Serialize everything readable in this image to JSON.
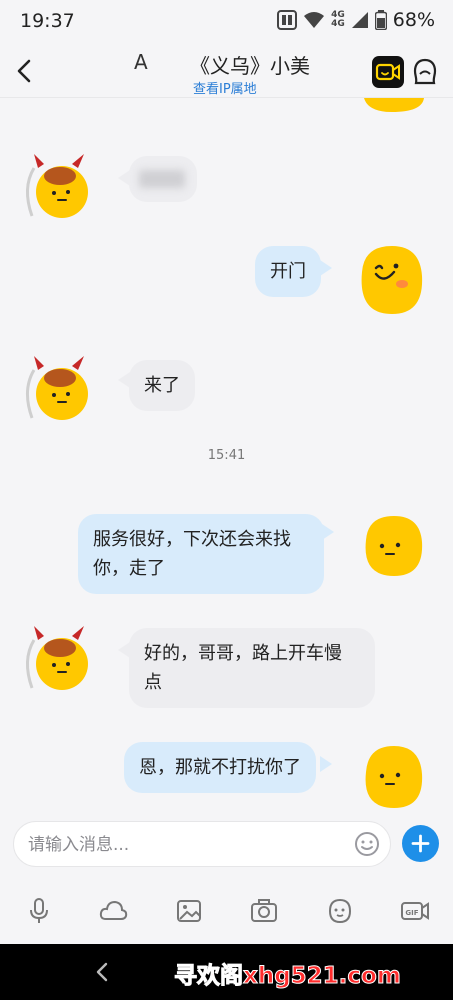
{
  "status_bar": {
    "time": "19:37",
    "network_1": "4G",
    "network_2": "4G",
    "battery": "68%"
  },
  "header": {
    "pre_title": "A",
    "title": "《义乌》小美",
    "subtitle": "查看IP属地"
  },
  "messages": [
    {
      "side": "in",
      "text": ""
    },
    {
      "side": "out",
      "text": "开门"
    },
    {
      "side": "in",
      "text": "来了"
    },
    {
      "side": "out",
      "text": "服务很好，下次还会来找\n你，走了"
    },
    {
      "side": "in",
      "text": "好的，哥哥，路上开车慢\n点"
    },
    {
      "side": "out",
      "text": "恩，那就不打扰你了"
    }
  ],
  "timestamp": "15:41",
  "composer": {
    "placeholder": "请输入消息..."
  },
  "toolbar": [
    "mic-icon",
    "cloud-icon",
    "image-icon",
    "camera-icon",
    "sticker-icon",
    "gif-icon"
  ],
  "nav": {
    "watermark": "寻欢阁xhg521.com"
  },
  "colors": {
    "accent": "#1e8fe8",
    "bubble_out": "#d8ebfb",
    "bubble_in": "#ededf0",
    "avatar_yellow": "#ffc800"
  }
}
